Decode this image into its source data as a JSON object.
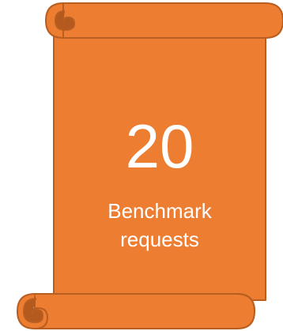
{
  "scroll": {
    "number": "20",
    "caption_line1": "Benchmark",
    "caption_line2": "requests"
  },
  "colors": {
    "scroll_fill": "#ED7D31",
    "scroll_outline": "#B85E21",
    "scroll_curl_shade": "#B45A1E",
    "text": "#FFFFFF"
  }
}
